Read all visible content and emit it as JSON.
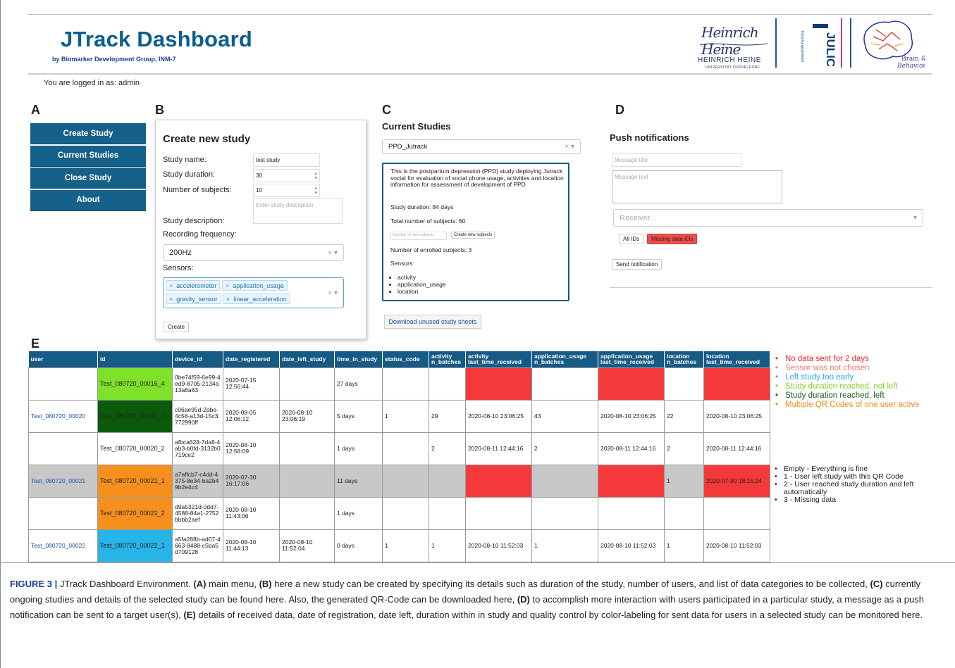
{
  "header": {
    "title": "JTrack Dashboard",
    "subtitle": "by Biomarker Development Group, INM-7",
    "logos": {
      "hhu_signature": "Heinrich Heine",
      "hhu_name": "HEINRICH HEINE",
      "hhu_university": "UNIVERSITÄT DÜSSELDORF",
      "juelich_name": "JÜLICH",
      "juelich_sub": "Forschungszentrum",
      "bb_line1": "Brain &",
      "bb_line2": "Behaviour"
    },
    "logged_in": "You are logged in as: admin"
  },
  "panel_letters": {
    "a": "A",
    "b": "B",
    "c": "C",
    "d": "D",
    "e": "E"
  },
  "menu": {
    "items": [
      "Create Study",
      "Current Studies",
      "Close Study",
      "About"
    ]
  },
  "create_study": {
    "title": "Create new study",
    "study_name_label": "Study name:",
    "study_name_value": "test study",
    "duration_label": "Study duration:",
    "duration_value": "30",
    "subjects_label": "Number of subjects:",
    "subjects_value": "10",
    "description_placeholder": "Enter study description",
    "description_label": "Study description:",
    "frequency_label": "Recording frequency:",
    "frequency_value": "200Hz",
    "sensors_label": "Sensors:",
    "sensor_tags": [
      "accelerometer",
      "application_usage",
      "gravity_sensor",
      "linear_acceleration"
    ],
    "create_button": "Create"
  },
  "current_studies": {
    "title": "Current Studies",
    "selected_study": "PPD_Jutrack",
    "description": "This is the postpartum depression (PPD) study deploying Jutrack social for evaluation of social phone usage, activities and location information for assessment of development of PPD",
    "duration": "Study duration: 84 days",
    "total_subjects": "Total number of subjects: 60",
    "new_subjects_placeholder": "Number of new subjects",
    "create_subjects_button": "Create new subjects",
    "enrolled": "Number of enrolled subjects: 3",
    "sensors_label": "Sensors:",
    "sensors": [
      "activity",
      "application_usage",
      "location"
    ],
    "download_button": "Download unused study sheets"
  },
  "push": {
    "title": "Push notifications",
    "message_title_placeholder": "Message title",
    "message_text_placeholder": "Message text",
    "receiver_placeholder": "Receiver...",
    "all_ids_button": "All IDs",
    "missing_ids_button": "Missing data IDs",
    "send_button": "Send notification"
  },
  "table": {
    "headers": [
      "user",
      "id",
      "device_id",
      "date_registered",
      "date_left_study",
      "time_in_study",
      "status_code",
      "activity n_batches",
      "activity last_time_received",
      "application_usage n_batches",
      "application_usage last_time_received",
      "location n_batches",
      "location last_time_received"
    ],
    "rows": [
      {
        "cells": [
          "",
          "Test_080720_00016_4",
          "0be74f59-6e99-4ed9-8705-2134a13a6a63",
          "2020-07-15 12:56:44",
          "",
          "27 days",
          "",
          "",
          "",
          "",
          "",
          "",
          ""
        ],
        "id_color": "#7ee12a",
        "row_color": "",
        "red": [
          8,
          10,
          12
        ]
      },
      {
        "cells": [
          "Test_080720_00020",
          "Test_080720_00020_1",
          "c06ae95d-2abe-4c58-a13d-15c3772990ff",
          "2020-08-05 12:06:12",
          "2020-08-10 23:06:19",
          "5 days",
          "1",
          "29",
          "2020-08-10 23:06:25",
          "43",
          "2020-08-10 23:06:25",
          "22",
          "2020-08-10 23:06:25"
        ],
        "id_color": "#0b5a0b",
        "row_color": "",
        "red": []
      },
      {
        "cells": [
          "",
          "Test_080720_00020_2",
          "afbca628-7da8-4ab3-b0fd-3132b0719ce2",
          "2020-08-10 12:58:09",
          "",
          "1 days",
          "",
          "2",
          "2020-08-11 12:44:16",
          "2",
          "2020-08-11 12:44:16",
          "2",
          "2020-08-11 12:44:16"
        ],
        "id_color": "",
        "row_color": "",
        "red": []
      },
      {
        "cells": [
          "Test_080720_00021",
          "Test_080720_00021_1",
          "a7affcb7-c4dd-4375-8e34-ba2b49b2e4c4",
          "2020-07-30 16:17:06",
          "",
          "11 days",
          "",
          "",
          "",
          "",
          "",
          "1",
          "2020-07-30 18:15:14"
        ],
        "id_color": "#f5901e",
        "row_color": "#c8c8c8",
        "red": [
          8,
          10,
          12
        ]
      },
      {
        "cells": [
          "",
          "Test_080720_00021_2",
          "d9a5321d-0dd7-4588-84a1-2752bbbb2aef",
          "2020-08-10 11:43:06",
          "",
          "1 days",
          "",
          "",
          "",
          "",
          "",
          "",
          ""
        ],
        "id_color": "#f5901e",
        "row_color": "",
        "red": []
      },
      {
        "cells": [
          "Test_080720_00022",
          "Test_080720_00022_1",
          "a5fa288b-ad07-4663-8488-c5ba5d709128",
          "2020-08-10 11:44:13",
          "2020-08-10 11:52:04",
          "0 days",
          "1",
          "1",
          "2020-08-10 11:52:03",
          "1",
          "2020-08-10 11:52:03",
          "1",
          "2020-08-10 11:52:03"
        ],
        "id_color": "#29b4e8",
        "row_color": "",
        "red": []
      }
    ]
  },
  "colors": {
    "header_blue": "#165a86",
    "red": "#f4393a",
    "grey_row": "#c8c8c8"
  },
  "legend": [
    {
      "text": "No data sent for 2 days",
      "color": "#ee2b2b"
    },
    {
      "text": "Sensor was not chosen",
      "color": "#f87a6e"
    },
    {
      "text": "Left study too early",
      "color": "#2ba9e6"
    },
    {
      "text": "Study duration reached, not left",
      "color": "#7ed321"
    },
    {
      "text": "Study duration reached, left",
      "color": "#1b5e1b"
    },
    {
      "text": "Multiple QR Codes of one user active",
      "color": "#f28c1c"
    }
  ],
  "status_codes": [
    "Empty - Everything is fine",
    "1 - User left study with this QR Code",
    "2 - User reached study duration and left automatically",
    "3 - Missing data"
  ],
  "caption": {
    "label": "FIGURE 3 |",
    "intro": " JTrack Dashboard Environment. ",
    "a": "(A)",
    "a_text": " main menu, ",
    "b": "(B)",
    "b_text": " here a new study can be created by specifying its details such as duration of the study, number of users, and list of data categories to be collected, ",
    "c": "(C)",
    "c_text": " currently ongoing studies and details of the selected study can be found here. Also, the generated QR-Code can be downloaded here, ",
    "d": "(D)",
    "d_text": " to accomplish more interaction with users participated in a particular study, a message as a push notification can be sent to a target user(s), ",
    "e": "(E)",
    "e_text": " details of received data, date of registration, date left, duration within in study and quality control by color-labeling for sent data for users in a selected study can be monitored here."
  }
}
